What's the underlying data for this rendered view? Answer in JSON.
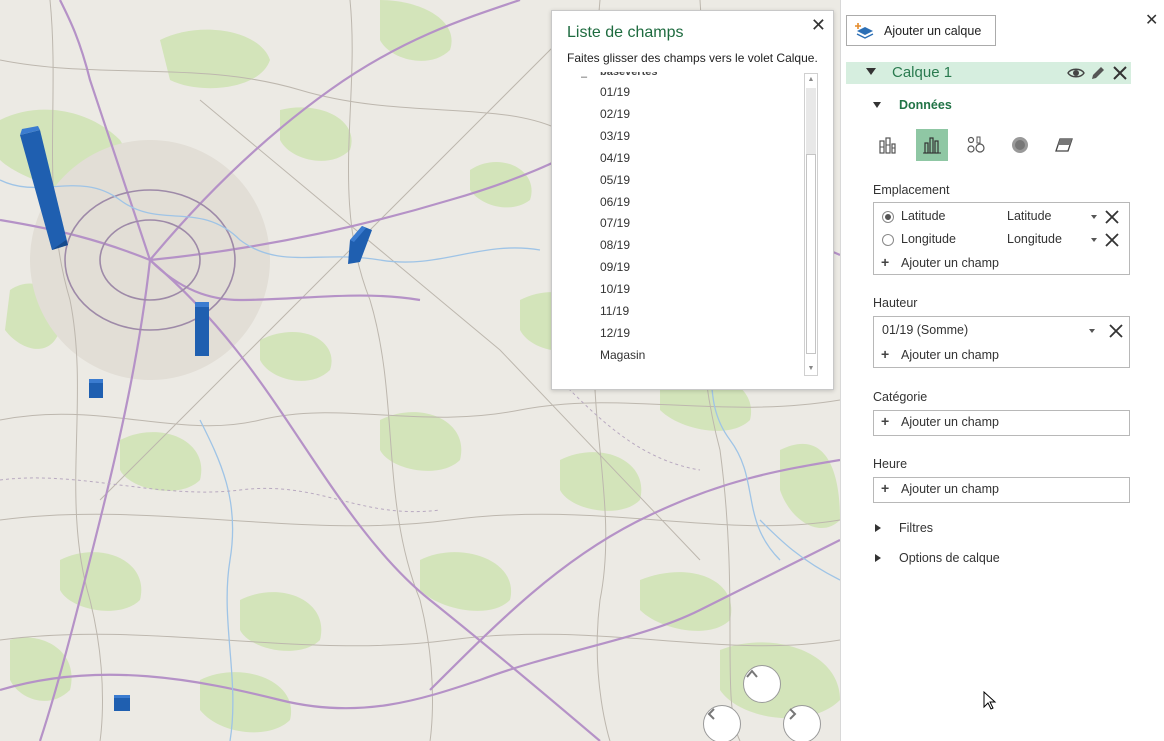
{
  "field_list": {
    "title": "Liste de champs",
    "hint": "Faites glisser des champs vers le volet Calque.",
    "group": "basevertes",
    "items": [
      "01/19",
      "02/19",
      "03/19",
      "04/19",
      "05/19",
      "06/19",
      "07/19",
      "08/19",
      "09/19",
      "10/19",
      "11/19",
      "12/19",
      "Magasin"
    ]
  },
  "panel": {
    "add_layer_label": "Ajouter un calque",
    "layer_name": "Calque 1",
    "data_section": "Données",
    "location": {
      "label": "Emplacement",
      "rows": [
        {
          "field": "Latitude",
          "type": "Latitude",
          "selected": true
        },
        {
          "field": "Longitude",
          "type": "Longitude",
          "selected": false
        }
      ],
      "add": "Ajouter un champ"
    },
    "height": {
      "label": "Hauteur",
      "value": "01/19 (Somme)",
      "add": "Ajouter un champ"
    },
    "category": {
      "label": "Catégorie",
      "add": "Ajouter un champ"
    },
    "time": {
      "label": "Heure",
      "add": "Ajouter un champ"
    },
    "filters": "Filtres",
    "layer_options": "Options de calque"
  },
  "colors": {
    "accent_green": "#217346",
    "layer_bar": "#d6eedf",
    "active_viz": "#8fc7a4",
    "column_blue": "#1f5fb0"
  }
}
